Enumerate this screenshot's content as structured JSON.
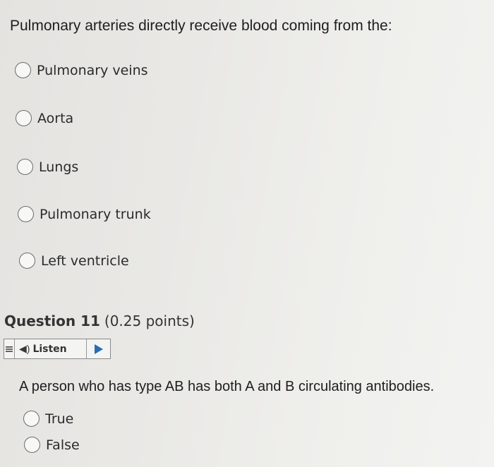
{
  "question_prev": {
    "text": "Pulmonary arteries directly receive blood coming from the:",
    "options": [
      {
        "label": "Pulmonary veins"
      },
      {
        "label": "Aorta"
      },
      {
        "label": "Lungs"
      },
      {
        "label": "Pulmonary trunk"
      },
      {
        "label": "Left ventricle"
      }
    ]
  },
  "question_11": {
    "number_label": "Question 11",
    "points_label": "(0.25 points)",
    "listen_label": "Listen",
    "icons": [
      "menu-icon",
      "speaker-icon",
      "play-icon"
    ],
    "text": "A person who has type AB has both A and B circulating antibodies.",
    "options": [
      {
        "label": "True"
      },
      {
        "label": "False"
      }
    ]
  },
  "colors": {
    "accent_play": "#2a6cb0",
    "background": "#ebeae7"
  }
}
